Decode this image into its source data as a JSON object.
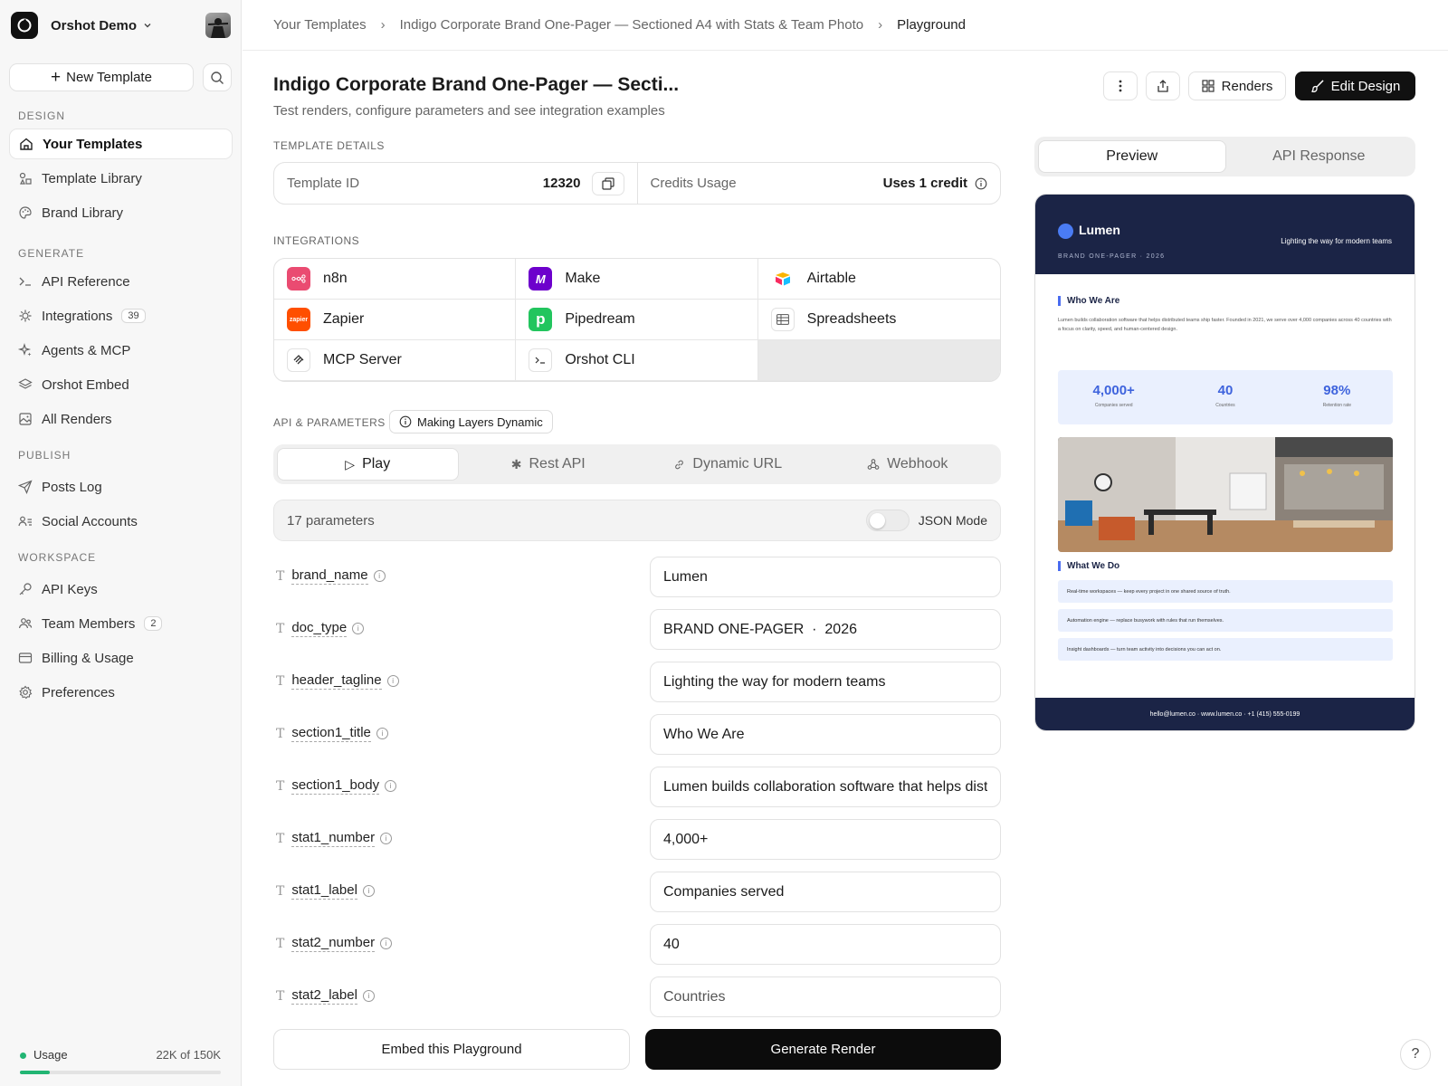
{
  "workspace": {
    "name": "Orshot Demo"
  },
  "sidebar": {
    "new_template": "New Template",
    "sections": {
      "design": "DESIGN",
      "generate": "GENERATE",
      "publish": "PUBLISH",
      "workspace": "WORKSPACE"
    },
    "items": [
      {
        "label": "Your Templates",
        "icon": "home-icon",
        "active": true
      },
      {
        "label": "Template Library",
        "icon": "shapes-icon"
      },
      {
        "label": "Brand Library",
        "icon": "palette-icon"
      },
      {
        "label": "API Reference",
        "icon": "terminal-icon"
      },
      {
        "label": "Integrations",
        "icon": "plug-icon",
        "badge": "39"
      },
      {
        "label": "Agents & MCP",
        "icon": "sparkles-icon"
      },
      {
        "label": "Orshot Embed",
        "icon": "layers-icon"
      },
      {
        "label": "All Renders",
        "icon": "image-icon"
      },
      {
        "label": "Posts Log",
        "icon": "send-icon"
      },
      {
        "label": "Social Accounts",
        "icon": "users-list-icon"
      },
      {
        "label": "API Keys",
        "icon": "key-icon"
      },
      {
        "label": "Team Members",
        "icon": "team-icon",
        "badge": "2"
      },
      {
        "label": "Billing & Usage",
        "icon": "wallet-icon"
      },
      {
        "label": "Preferences",
        "icon": "gear-icon"
      }
    ],
    "usage": {
      "label": "Usage",
      "value": "22K of 150K",
      "fraction": 0.147
    }
  },
  "breadcrumb": {
    "items": [
      "Your Templates",
      "Indigo Corporate Brand One-Pager — Sectioned A4 with Stats & Team Photo",
      "Playground"
    ]
  },
  "header": {
    "title": "Indigo Corporate Brand One-Pager — Secti...",
    "subtitle": "Test renders, configure parameters and see integration examples",
    "renders_label": "Renders",
    "edit_label": "Edit Design"
  },
  "details": {
    "section_label": "TEMPLATE DETAILS",
    "template_id_label": "Template ID",
    "template_id": "12320",
    "credits_label": "Credits Usage",
    "credits_value": "Uses 1 credit"
  },
  "integrations": {
    "section_label": "INTEGRATIONS",
    "items": [
      {
        "label": "n8n",
        "icon": "n8n-icon",
        "color": "#ea4b71"
      },
      {
        "label": "Make",
        "icon": "make-icon",
        "color": "#6d00cc"
      },
      {
        "label": "Airtable",
        "icon": "airtable-icon",
        "color": "#fcb400"
      },
      {
        "label": "Zapier",
        "icon": "zapier-icon",
        "color": "#ff4f00"
      },
      {
        "label": "Pipedream",
        "icon": "pipedream-icon",
        "color": "#22c55e"
      },
      {
        "label": "Spreadsheets",
        "icon": "spreadsheet-icon",
        "color": "#ffffff"
      },
      {
        "label": "MCP Server",
        "icon": "mcp-icon",
        "color": "#ffffff"
      },
      {
        "label": "Orshot CLI",
        "icon": "cli-icon",
        "color": "#ffffff"
      }
    ]
  },
  "api": {
    "section_label": "API & PARAMETERS",
    "making_dynamic": "Making Layers Dynamic",
    "tabs": [
      "Play",
      "Rest API",
      "Dynamic URL",
      "Webhook"
    ],
    "active_tab": "Play",
    "params_count": "17 parameters",
    "json_mode": "JSON Mode"
  },
  "params": [
    {
      "name": "brand_name",
      "value": "Lumen"
    },
    {
      "name": "doc_type",
      "value": "BRAND ONE-PAGER  ·  2026"
    },
    {
      "name": "header_tagline",
      "value": "Lighting the way for modern teams"
    },
    {
      "name": "section1_title",
      "value": "Who We Are"
    },
    {
      "name": "section1_body",
      "value": "Lumen builds collaboration software that helps distributed teams ship faster."
    },
    {
      "name": "stat1_number",
      "value": "4,000+"
    },
    {
      "name": "stat1_label",
      "value": "Companies served"
    },
    {
      "name": "stat2_number",
      "value": "40"
    },
    {
      "name": "stat2_label",
      "value": "Countries"
    }
  ],
  "actions": {
    "embed": "Embed this Playground",
    "generate": "Generate Render"
  },
  "preview_panel": {
    "tabs": [
      "Preview",
      "API Response"
    ],
    "doc": {
      "brand": "Lumen",
      "doc_type": "BRAND ONE-PAGER · 2026",
      "tagline": "Lighting the way for modern teams",
      "section1_title": "Who We Are",
      "section1_body": "Lumen builds collaboration software that helps distributed teams ship faster. Founded in 2021, we serve over 4,000 companies across 40 countries with a focus on clarity, speed, and human-centered design.",
      "stats": [
        {
          "number": "4,000+",
          "label": "Companies served"
        },
        {
          "number": "40",
          "label": "Countries"
        },
        {
          "number": "98%",
          "label": "Retention rate"
        }
      ],
      "section2_title": "What We Do",
      "items": [
        "Real-time workspaces — keep every project in one shared source of truth.",
        "Automation engine — replace busywork with rules that run themselves.",
        "Insight dashboards — turn team activity into decisions you can act on."
      ],
      "footer": "hello@lumen.co · www.lumen.co · +1 (415) 555-0199"
    }
  },
  "help": "?"
}
